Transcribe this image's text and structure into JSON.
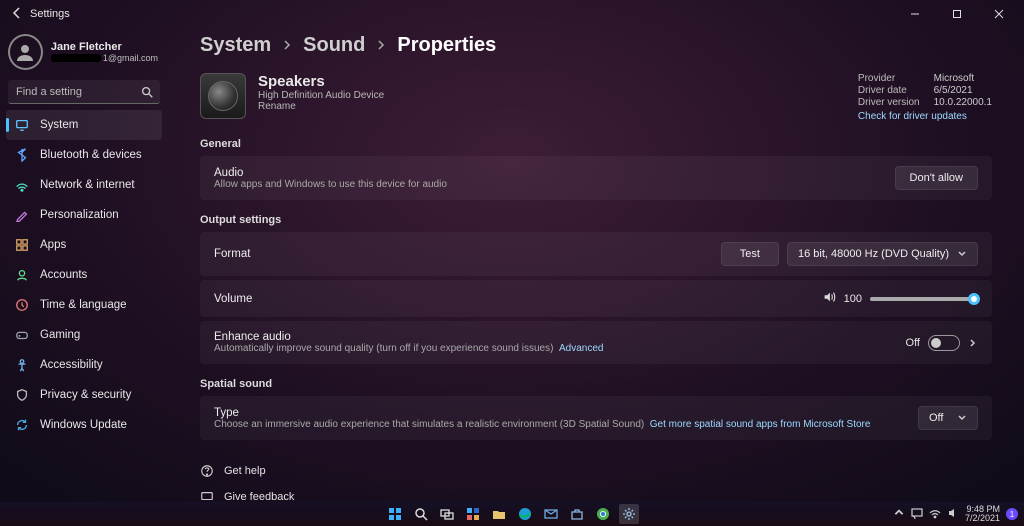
{
  "titlebar": {
    "app_name": "Settings"
  },
  "user": {
    "name": "Jane Fletcher",
    "email_suffix": "1@gmail.com"
  },
  "search": {
    "placeholder": "Find a setting"
  },
  "sidebar": {
    "items": [
      {
        "label": "System"
      },
      {
        "label": "Bluetooth & devices"
      },
      {
        "label": "Network & internet"
      },
      {
        "label": "Personalization"
      },
      {
        "label": "Apps"
      },
      {
        "label": "Accounts"
      },
      {
        "label": "Time & language"
      },
      {
        "label": "Gaming"
      },
      {
        "label": "Accessibility"
      },
      {
        "label": "Privacy & security"
      },
      {
        "label": "Windows Update"
      }
    ]
  },
  "breadcrumb": {
    "a": "System",
    "b": "Sound",
    "c": "Properties"
  },
  "device": {
    "name": "Speakers",
    "sub": "High Definition Audio Device",
    "rename": "Rename"
  },
  "driver": {
    "provider_k": "Provider",
    "provider_v": "Microsoft",
    "date_k": "Driver date",
    "date_v": "6/5/2021",
    "ver_k": "Driver version",
    "ver_v": "10.0.22000.1",
    "check": "Check for driver updates"
  },
  "sections": {
    "general": "General",
    "output": "Output settings",
    "spatial": "Spatial sound"
  },
  "audio": {
    "title": "Audio",
    "sub": "Allow apps and Windows to use this device for audio",
    "btn": "Don't allow"
  },
  "format": {
    "title": "Format",
    "test": "Test",
    "value": "16 bit, 48000 Hz (DVD Quality)"
  },
  "volume": {
    "title": "Volume",
    "value": "100"
  },
  "enhance": {
    "title": "Enhance audio",
    "sub": "Automatically improve sound quality (turn off if you experience sound issues)",
    "adv": "Advanced",
    "state": "Off"
  },
  "spatial": {
    "title": "Type",
    "sub": "Choose an immersive audio experience that simulates a realistic environment (3D Spatial Sound)",
    "link": "Get more spatial sound apps from Microsoft Store",
    "value": "Off"
  },
  "footer": {
    "help": "Get help",
    "feedback": "Give feedback"
  },
  "tray": {
    "time": "9:48 PM",
    "date": "7/2/2021",
    "notif": "1"
  }
}
